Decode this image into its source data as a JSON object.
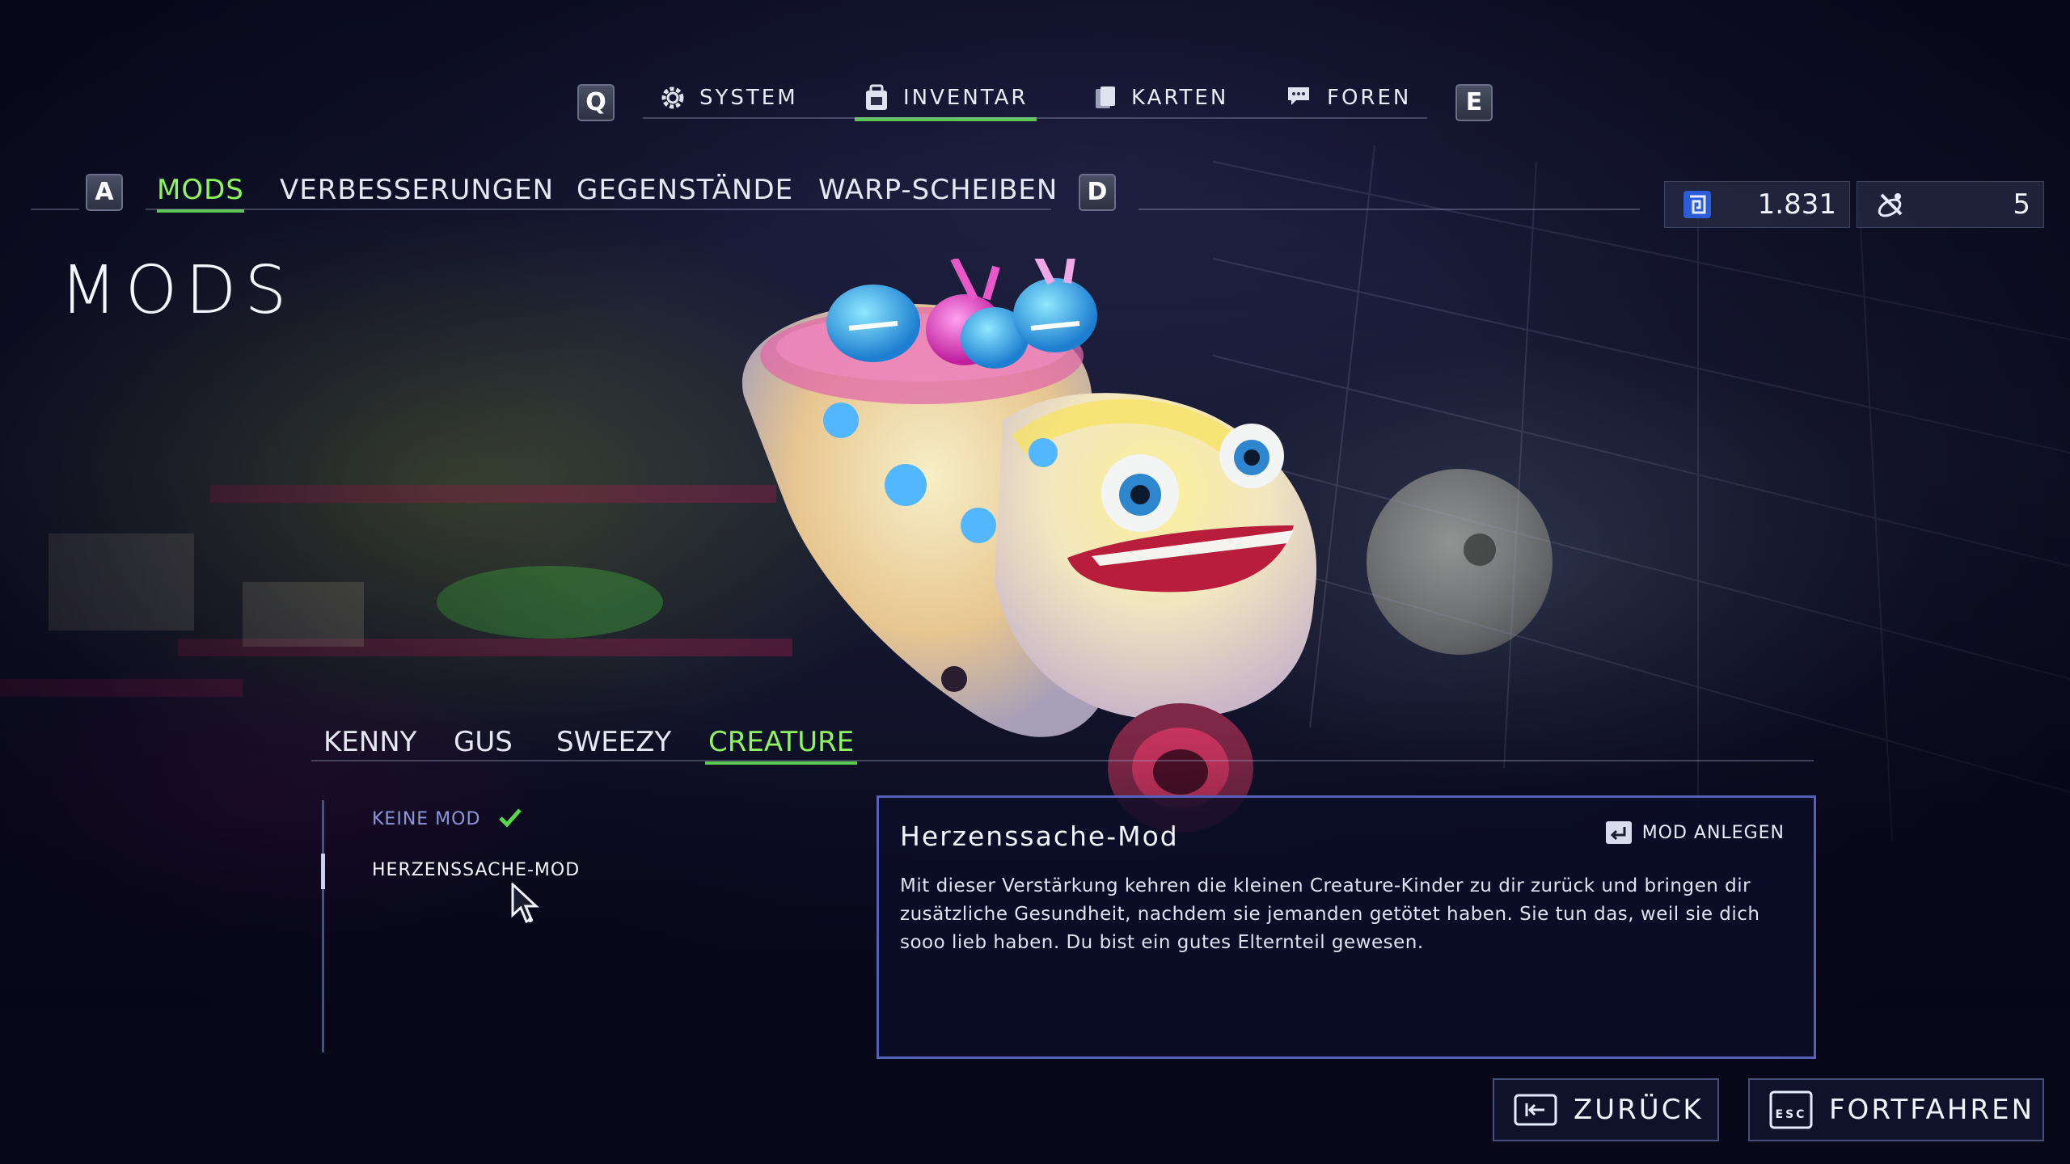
{
  "top_nav": {
    "left_key": "Q",
    "right_key": "E",
    "tabs": [
      {
        "label": "SYSTEM",
        "icon": "gear-icon"
      },
      {
        "label": "INVENTAR",
        "icon": "backpack-icon"
      },
      {
        "label": "KARTEN",
        "icon": "cards-icon"
      },
      {
        "label": "FOREN",
        "icon": "chat-icon"
      }
    ],
    "active": "INVENTAR"
  },
  "sub_nav": {
    "left_key": "A",
    "right_key": "D",
    "tabs": [
      "MODS",
      "VERBESSERUNGEN",
      "GEGENSTÄNDE",
      "WARP-SCHEIBEN"
    ],
    "active": "MODS"
  },
  "currencies": [
    {
      "icon": "currency-chip-icon",
      "value": "1.831"
    },
    {
      "icon": "satellite-icon",
      "value": "5"
    }
  ],
  "page_title": "MODS",
  "character_tabs": {
    "tabs": [
      "KENNY",
      "GUS",
      "SWEEZY",
      "CREATURE"
    ],
    "active": "CREATURE"
  },
  "mod_list": [
    {
      "label": "KEINE MOD",
      "equipped": true
    },
    {
      "label": "HERZENSSACHE-MOD",
      "equipped": false
    }
  ],
  "detail": {
    "title": "Herzenssache-Mod",
    "action_label": "MOD ANLEGEN",
    "description": "Mit dieser Verstärkung kehren die kleinen Creature-Kinder zu dir zurück und bringen dir zusätzliche Gesundheit, nachdem sie jemanden getötet haben. Sie tun das, weil sie dich sooo lieb haben. Du bist ein gutes Elternteil gewesen."
  },
  "bottom_buttons": {
    "back_label": "ZURÜCK",
    "continue_label": "FORTFAHREN",
    "esc_key": "ESC"
  },
  "colors": {
    "accent_green": "#58c84e",
    "active_text": "#8ef55e",
    "box_border": "#5560b8"
  }
}
